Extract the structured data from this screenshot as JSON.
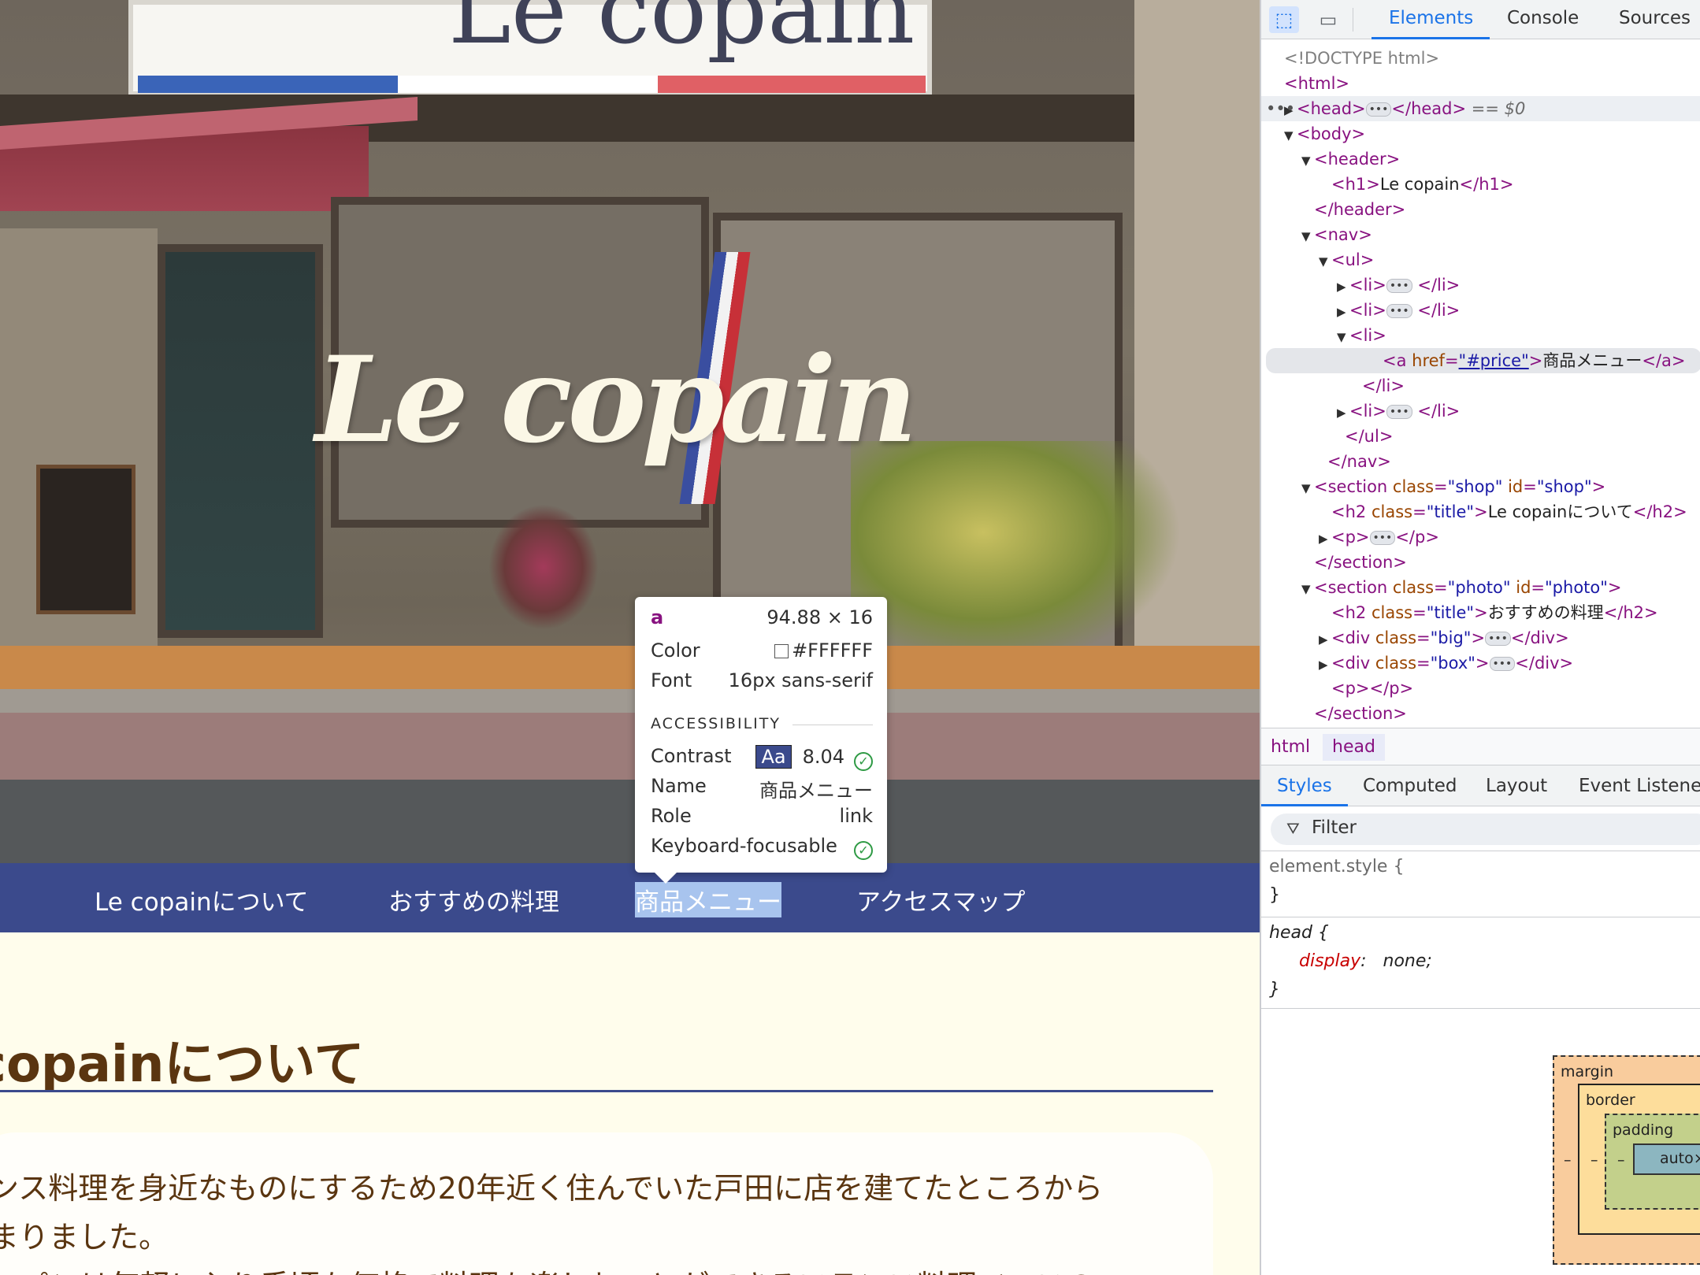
{
  "webpage": {
    "sign_text": "Le copain",
    "hero_logo": "Le copain",
    "nav": [
      {
        "label": "Le copainについて"
      },
      {
        "label": "おすすめの料理"
      },
      {
        "label": "商品メニュー"
      },
      {
        "label": "アクセスマップ"
      }
    ],
    "section_title": "copainについて",
    "paragraph_lines": [
      "ンス料理を身近なものにするため20年近く住んでいた戸田に店を建てたところから",
      "まりました。",
      "コパンは気軽に入り手頃な価格で料理を楽しむことができるフランス料理ベースの"
    ]
  },
  "tooltip": {
    "tag": "a",
    "size": "94.88 × 16",
    "color_label": "Color",
    "color_value": "#FFFFFF",
    "font_label": "Font",
    "font_value": "16px sans-serif",
    "section": "ACCESSIBILITY",
    "contrast_label": "Contrast",
    "contrast_badge": "Aa",
    "contrast_value": "8.04",
    "name_label": "Name",
    "name_value": "商品メニュー",
    "role_label": "Role",
    "role_value": "link",
    "focus_label": "Keyboard-focusable"
  },
  "devtools": {
    "tabs": [
      "Elements",
      "Console",
      "Sources"
    ],
    "dom": {
      "doctype": "<!DOCTYPE html>",
      "html": "<html>",
      "head_open": "<head>",
      "head_close": "</head>",
      "eq": "== $0",
      "body": "<body>",
      "header_open": "<header>",
      "h1_open": "<h1>",
      "h1_text": "Le copain",
      "h1_close": "</h1>",
      "header_close": "</header>",
      "nav_open": "<nav>",
      "ul_open": "<ul>",
      "li_open": "<li>",
      "li_close": "</li>",
      "a_open": "<a ",
      "a_href_name": "href",
      "a_href_value": "\"#price\"",
      "a_text": "商品メニュー",
      "a_close": "</a>",
      "ul_close": "</ul>",
      "nav_close": "</nav>",
      "section_shop_open": "<section ",
      "class_attr": "class",
      "id_attr": "id",
      "shop_class": "\"shop\"",
      "shop_id": "\"shop\"",
      "h2_open": "<h2 ",
      "title_class": "\"title\"",
      "h2_shop_text": "Le copainについて",
      "h2_close": "</h2>",
      "p_open": "<p>",
      "p_close": "</p>",
      "section_close": "</section>",
      "photo_class": "\"photo\"",
      "photo_id": "\"photo\"",
      "h2_photo_text": "おすすめの料理",
      "div_open": "<div ",
      "big_class": "\"big\"",
      "box_class": "\"box\"",
      "div_close": "</div>",
      "p_empty": "<p></p>"
    },
    "breadcrumbs": [
      "html",
      "head"
    ],
    "style_tabs": [
      "Styles",
      "Computed",
      "Layout",
      "Event Listeners"
    ],
    "filter_placeholder": "Filter",
    "element_style_open": "element.style {",
    "brace_close": "}",
    "head_rule_open": "head {",
    "head_rule_prop": "display",
    "head_rule_value": "none;",
    "box_model": {
      "margin": "margin",
      "border": "border",
      "padding": "padding",
      "content": "auto×",
      "dash": "–"
    }
  }
}
